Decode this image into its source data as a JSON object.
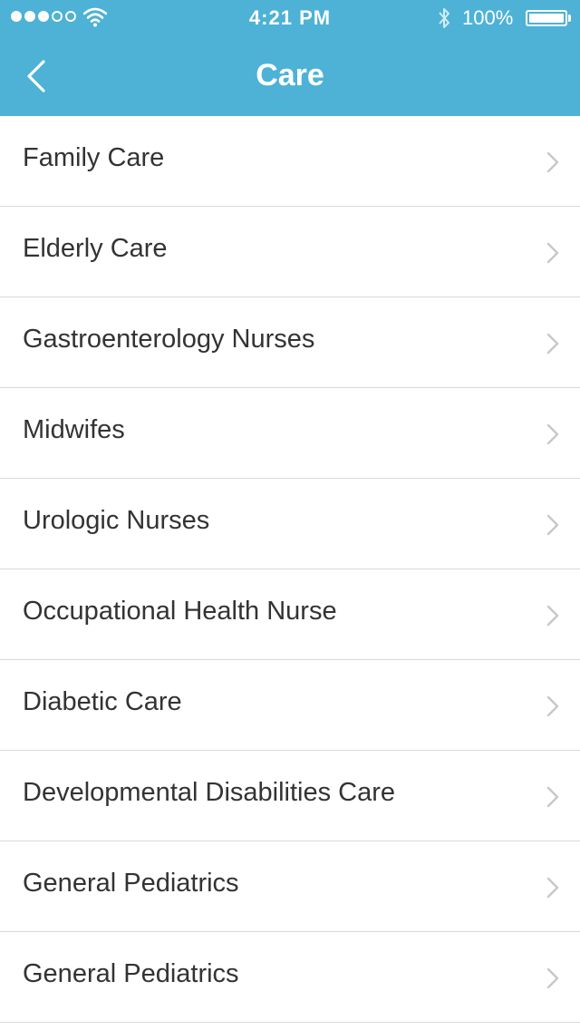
{
  "status_bar": {
    "signal_filled": 3,
    "signal_total": 5,
    "wifi_icon": "wifi-icon",
    "time": "4:21 PM",
    "bluetooth_icon": "bluetooth-icon",
    "battery_percent": "100%",
    "battery_level": 1.0
  },
  "nav": {
    "title": "Care",
    "back_icon": "chevron-left-icon"
  },
  "colors": {
    "header_bg": "#4db2d6",
    "header_text": "#ffffff",
    "item_text": "#333333",
    "separator": "#d9d9d9",
    "chevron": "#c7c7cc"
  },
  "list": {
    "items": [
      {
        "label": "Family Care"
      },
      {
        "label": "Elderly Care"
      },
      {
        "label": "Gastroenterology Nurses"
      },
      {
        "label": "Midwifes"
      },
      {
        "label": "Urologic Nurses"
      },
      {
        "label": "Occupational Health Nurse"
      },
      {
        "label": "Diabetic Care"
      },
      {
        "label": "Developmental Disabilities Care"
      },
      {
        "label": "General Pediatrics"
      },
      {
        "label": "General Pediatrics"
      }
    ],
    "chevron_icon": "chevron-right-icon"
  }
}
